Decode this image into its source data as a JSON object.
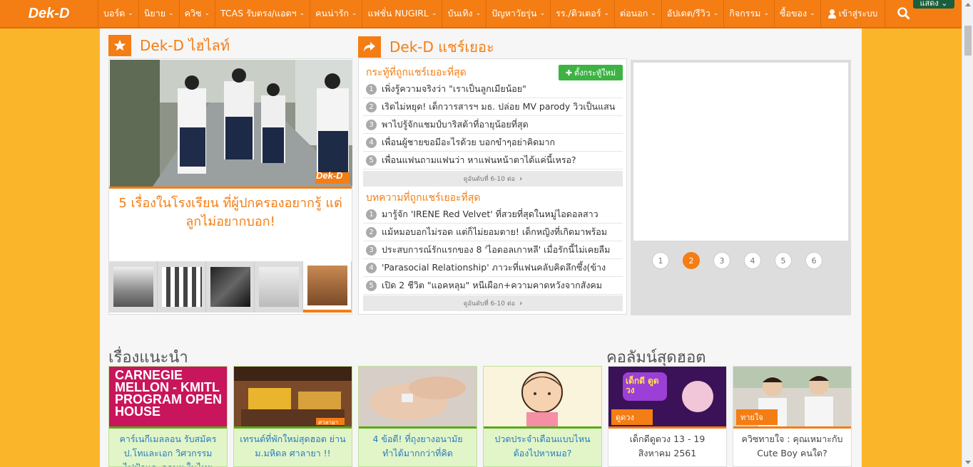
{
  "nav": {
    "logo": "Dek-D",
    "items": [
      "บอร์ด",
      "นิยาย",
      "ควิซ",
      "TCAS รับตรง/แอดฯ",
      "คนน่ารัก",
      "แฟชั่น NUGIRL",
      "บันเทิง",
      "ปัญหาวัยรุ่น",
      "รร./ติวเตอร์",
      "ต่อนอก",
      "อัปเดต/รีวิว",
      "กิจกรรม",
      "ซื้อของ"
    ],
    "login": "เข้าสู่ระบบ",
    "show_label": "แสดง"
  },
  "highlight": {
    "title": "Dek-D ไฮไลท์",
    "caption": "5 เรื่องในโรงเรียน ที่ผู้ปกครองอยากรู้ แต่ลูกไม่อยากบอก!",
    "watermark": "Dek-D",
    "thumb_active": 5
  },
  "share": {
    "title": "Dek-D แชร์เยอะ",
    "new_topic": "ตั้งกระทู้ใหม่",
    "board_sub": "กระทู้ที่ถูกแชร์เยอะที่สุด",
    "board_items": [
      {
        "n": "1",
        "t": "เพิ่งรู้ความจริงว่า \"เราเป็นลูกเมียน้อย\""
      },
      {
        "n": "2",
        "t": "เริดไม่หยุด! เด็กวารสารฯ มธ. ปล่อย MV parody วิวเป็นแสน"
      },
      {
        "n": "3",
        "t": "พาไปรู้จักแชมป์บาริสต้าที่อายุน้อยที่สุด"
      },
      {
        "n": "4",
        "t": "เพื่อนผู้ชายขอมีอะไรด้วย บอกขำๆอย่าคิดมาก"
      },
      {
        "n": "5",
        "t": "เพื่อนแฟนถามแฟนว่า หาแฟนหน้าตาได้แค่นี้เหรอ?"
      }
    ],
    "more1": "ดูอันดับที่ 6-10 ต่อ",
    "article_sub": "บทความที่ถูกแชร์เยอะที่สุด",
    "article_items": [
      {
        "n": "1",
        "t": "มารู้จัก 'IRENE Red Velvet' ที่สวยที่สุดในหมู่ไอดอลสาว"
      },
      {
        "n": "2",
        "t": "แม้หมอบอกไม่รอด แต่ก็ไม่ยอมตาย! เด็กหญิงที่เกิดมาพร้อม"
      },
      {
        "n": "3",
        "t": "ประสบการณ์รักแรกของ 8 'ไอดอลเกาหลี' เมื่อรักนี้ไม่เคยลืม"
      },
      {
        "n": "4",
        "t": "'Parasocial Relationship' ภาวะที่แฟนคลับคิดลึกซึ้ง(ข้าง"
      },
      {
        "n": "5",
        "t": "เปิด 2 ชีวิต \"แอคหลุม\" หนีเผือก+ความคาดหวังจากสังคม"
      }
    ],
    "more2": "ดูอันดับที่ 6-10 ต่อ",
    "pages": [
      "1",
      "2",
      "3",
      "4",
      "5",
      "6"
    ],
    "active_page": "2"
  },
  "recommend": {
    "title": "เรื่องแนะนำ",
    "cards": [
      {
        "text": "คาร์เนกีเมลลอน รับสมัคร ป.โทและเอก วิศวกรรมไฟฟ้าและคอมฯ ในไทย",
        "img_text": "CARNEGIE MELLON - KMITL PROGRAM OPEN HOUSE"
      },
      {
        "text": "เทรนด์ที่พักใหม่สุดฮอต ย่าน ม.มหิดล ศาลายา !!",
        "img_text": "ศาลายา"
      },
      {
        "text": "4 ข้อดี! ที่ถุงยางอนามัย ทำได้มากกว่าที่คิด",
        "img_text": ""
      },
      {
        "text": "ปวดประจำเดือนแบบไหน ต้องไปหาหมอ?",
        "img_text": ""
      }
    ]
  },
  "columns": {
    "title": "คอลัมน์สุดฮอต",
    "cards": [
      {
        "tag": "ดูดวง",
        "text": "เด็กดีดูดวง 13 - 19 สิงหาคม 2561",
        "img_text": "เด็กดี ดูดวง"
      },
      {
        "tag": "ทายใจ",
        "text": "ควิซทายใจ : คุณเหมาะกับ Cute Boy คนใด?"
      }
    ]
  }
}
